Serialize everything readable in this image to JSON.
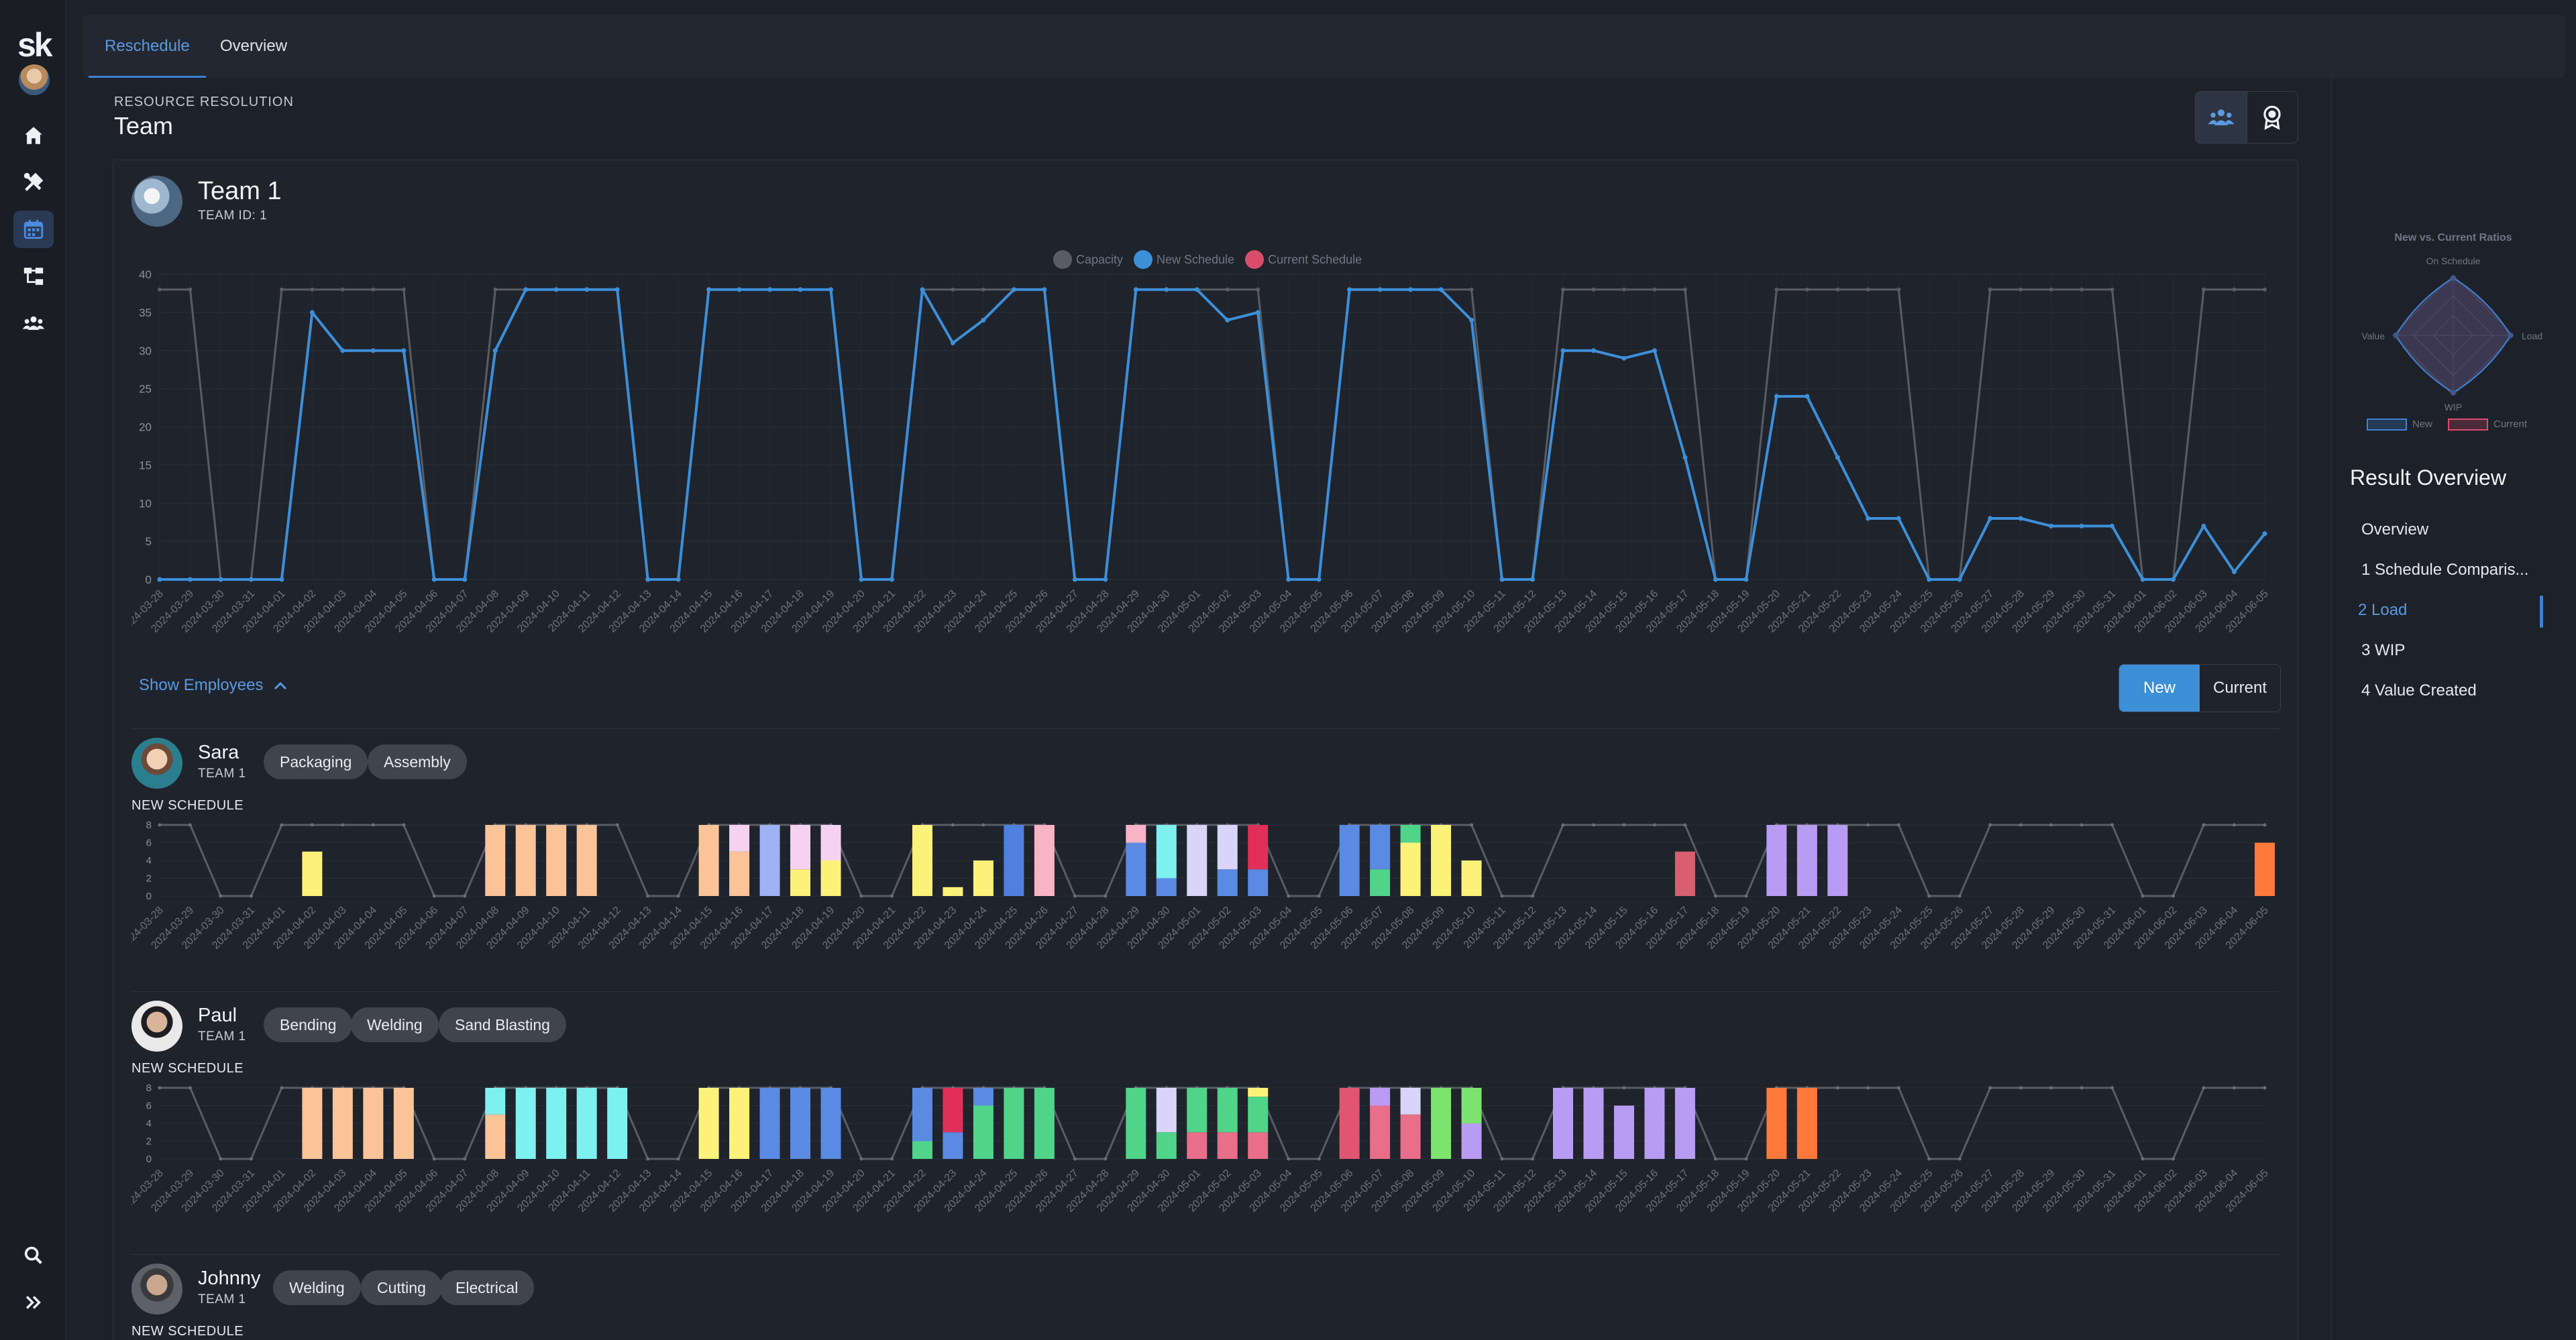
{
  "app": {
    "logo": "sk"
  },
  "nav": {
    "items": [
      {
        "name": "home",
        "icon": "home-icon"
      },
      {
        "name": "tools",
        "icon": "tools-icon"
      },
      {
        "name": "schedule",
        "icon": "calendar-icon",
        "active": true
      },
      {
        "name": "hierarchy",
        "icon": "hierarchy-icon"
      },
      {
        "name": "teams",
        "icon": "team-icon"
      }
    ],
    "bottom": [
      {
        "icon": "search-icon"
      },
      {
        "icon": "expand-icon"
      }
    ]
  },
  "tabs": [
    {
      "label": "Reschedule",
      "active": true
    },
    {
      "label": "Overview",
      "active": false
    }
  ],
  "header": {
    "section_label": "RESOURCE RESOLUTION",
    "title": "Team",
    "view_toggle": [
      {
        "icon": "team-icon",
        "active": true
      },
      {
        "icon": "award-icon",
        "active": false
      }
    ]
  },
  "team": {
    "name": "Team 1",
    "id_label": "TEAM ID: 1",
    "legend": [
      {
        "label": "Capacity",
        "color": "#595c64"
      },
      {
        "label": "New Schedule",
        "color": "#3d8fd8"
      },
      {
        "label": "Current Schedule",
        "color": "#d94d6b"
      }
    ],
    "show_employees_label": "Show Employees",
    "schedule_toggle": {
      "new_label": "New",
      "current_label": "Current",
      "active": "New"
    }
  },
  "chart_data": [
    {
      "type": "line",
      "title": "",
      "x": [
        "2024-03-28",
        "2024-03-29",
        "2024-03-30",
        "2024-03-31",
        "2024-04-01",
        "2024-04-02",
        "2024-04-03",
        "2024-04-04",
        "2024-04-05",
        "2024-04-06",
        "2024-04-07",
        "2024-04-08",
        "2024-04-09",
        "2024-04-10",
        "2024-04-11",
        "2024-04-12",
        "2024-04-13",
        "2024-04-14",
        "2024-04-15",
        "2024-04-16",
        "2024-04-17",
        "2024-04-18",
        "2024-04-19",
        "2024-04-20",
        "2024-04-21",
        "2024-04-22",
        "2024-04-23",
        "2024-04-24",
        "2024-04-25",
        "2024-04-26",
        "2024-04-27",
        "2024-04-28",
        "2024-04-29",
        "2024-04-30",
        "2024-05-01",
        "2024-05-02",
        "2024-05-03",
        "2024-05-04",
        "2024-05-05",
        "2024-05-06",
        "2024-05-07",
        "2024-05-08",
        "2024-05-09",
        "2024-05-10",
        "2024-05-11",
        "2024-05-12",
        "2024-05-13",
        "2024-05-14",
        "2024-05-15",
        "2024-05-16",
        "2024-05-17",
        "2024-05-18",
        "2024-05-19",
        "2024-05-20",
        "2024-05-21",
        "2024-05-22",
        "2024-05-23",
        "2024-05-24",
        "2024-05-25",
        "2024-05-26",
        "2024-05-27",
        "2024-05-28",
        "2024-05-29",
        "2024-05-30",
        "2024-05-31",
        "2024-06-01",
        "2024-06-02",
        "2024-06-03",
        "2024-06-04",
        "2024-06-05"
      ],
      "ylim": [
        0,
        40
      ],
      "yticks": [
        0,
        5,
        10,
        15,
        20,
        25,
        30,
        35,
        40
      ],
      "series": [
        {
          "name": "Capacity",
          "color": "#595c64",
          "values": [
            38,
            38,
            0,
            0,
            38,
            38,
            38,
            38,
            38,
            0,
            0,
            38,
            38,
            38,
            38,
            38,
            0,
            0,
            38,
            38,
            38,
            38,
            38,
            0,
            0,
            38,
            38,
            38,
            38,
            38,
            0,
            0,
            38,
            38,
            38,
            38,
            38,
            0,
            0,
            38,
            38,
            38,
            38,
            38,
            0,
            0,
            38,
            38,
            38,
            38,
            38,
            0,
            0,
            38,
            38,
            38,
            38,
            38,
            0,
            0,
            38,
            38,
            38,
            38,
            38,
            0,
            0,
            38,
            38,
            38
          ]
        },
        {
          "name": "New Schedule",
          "color": "#3d8fd8",
          "values": [
            0,
            0,
            0,
            0,
            0,
            35,
            30,
            30,
            30,
            0,
            0,
            30,
            38,
            38,
            38,
            38,
            0,
            0,
            38,
            38,
            38,
            38,
            38,
            0,
            0,
            38,
            31,
            34,
            38,
            38,
            0,
            0,
            38,
            38,
            38,
            34,
            35,
            0,
            0,
            38,
            38,
            38,
            38,
            34,
            0,
            0,
            30,
            30,
            29,
            30,
            16,
            0,
            0,
            24,
            24,
            16,
            8,
            8,
            0,
            0,
            8,
            8,
            7,
            7,
            7,
            0,
            0,
            7,
            1,
            6
          ]
        },
        {
          "name": "Current Schedule",
          "color": "#d94d6b",
          "values": []
        }
      ]
    },
    {
      "type": "bar",
      "title": "Sara",
      "ylim": [
        0,
        8
      ],
      "yticks": [
        0,
        2,
        4,
        6,
        8
      ],
      "x": [
        "2024-03-28",
        "2024-03-29",
        "2024-03-30",
        "2024-03-31",
        "2024-04-01",
        "2024-04-02",
        "2024-04-03",
        "2024-04-04",
        "2024-04-05",
        "2024-04-06",
        "2024-04-07",
        "2024-04-08",
        "2024-04-09",
        "2024-04-10",
        "2024-04-11",
        "2024-04-12",
        "2024-04-13",
        "2024-04-14",
        "2024-04-15",
        "2024-04-16",
        "2024-04-17",
        "2024-04-18",
        "2024-04-19",
        "2024-04-20",
        "2024-04-21",
        "2024-04-22",
        "2024-04-23",
        "2024-04-24",
        "2024-04-25",
        "2024-04-26",
        "2024-04-27",
        "2024-04-28",
        "2024-04-29",
        "2024-04-30",
        "2024-05-01",
        "2024-05-02",
        "2024-05-03",
        "2024-05-04",
        "2024-05-05",
        "2024-05-06",
        "2024-05-07",
        "2024-05-08",
        "2024-05-09",
        "2024-05-10",
        "2024-05-11",
        "2024-05-12",
        "2024-05-13",
        "2024-05-14",
        "2024-05-15",
        "2024-05-16",
        "2024-05-17",
        "2024-05-18",
        "2024-05-19",
        "2024-05-20",
        "2024-05-21",
        "2024-05-22",
        "2024-05-23",
        "2024-05-24",
        "2024-05-25",
        "2024-05-26",
        "2024-05-27",
        "2024-05-28",
        "2024-05-29",
        "2024-05-30",
        "2024-05-31",
        "2024-06-01",
        "2024-06-02",
        "2024-06-03",
        "2024-06-04",
        "2024-06-05"
      ],
      "capacity": [
        8,
        8,
        0,
        0,
        8,
        8,
        8,
        8,
        8,
        0,
        0,
        8,
        8,
        8,
        8,
        8,
        0,
        0,
        8,
        8,
        8,
        8,
        8,
        0,
        0,
        8,
        8,
        8,
        8,
        8,
        0,
        0,
        8,
        8,
        8,
        8,
        8,
        0,
        0,
        8,
        8,
        8,
        8,
        8,
        0,
        0,
        8,
        8,
        8,
        8,
        8,
        0,
        0,
        8,
        8,
        8,
        8,
        8,
        0,
        0,
        8,
        8,
        8,
        8,
        8,
        0,
        0,
        8,
        8,
        8
      ],
      "bars": {
        "5": [
          [
            5,
            "#fdf279"
          ]
        ],
        "11": [
          [
            8,
            "#fbc398"
          ]
        ],
        "12": [
          [
            8,
            "#fbc398"
          ]
        ],
        "13": [
          [
            8,
            "#fbc398"
          ]
        ],
        "14": [
          [
            8,
            "#fbc398"
          ]
        ],
        "18": [
          [
            8,
            "#fbc398"
          ]
        ],
        "19": [
          [
            5,
            "#fbc398"
          ],
          [
            3,
            "#f6d2f0"
          ]
        ],
        "20": [
          [
            8,
            "#9fb2f3"
          ]
        ],
        "21": [
          [
            3,
            "#fdf279"
          ],
          [
            5,
            "#f6d2f0"
          ]
        ],
        "22": [
          [
            4,
            "#fdf279"
          ],
          [
            4,
            "#f6d2f0"
          ]
        ],
        "25": [
          [
            8,
            "#fdf279"
          ]
        ],
        "26": [
          [
            1,
            "#fdf279"
          ]
        ],
        "27": [
          [
            4,
            "#fdf279"
          ]
        ],
        "28": [
          [
            8,
            "#4f80df"
          ]
        ],
        "29": [
          [
            8,
            "#f8b4c4"
          ]
        ],
        "32": [
          [
            6,
            "#5b8ae3"
          ],
          [
            2,
            "#f8b4c4"
          ]
        ],
        "33": [
          [
            2,
            "#5b8ae3"
          ],
          [
            6,
            "#7df0f0"
          ]
        ],
        "34": [
          [
            8,
            "#d9d4f8"
          ]
        ],
        "35": [
          [
            3,
            "#5b8ae3"
          ],
          [
            5,
            "#d9d4f8"
          ]
        ],
        "36": [
          [
            3,
            "#5b8ae3"
          ],
          [
            5,
            "#e0305a"
          ]
        ],
        "39": [
          [
            8,
            "#5b8ae3"
          ]
        ],
        "40": [
          [
            3,
            "#4fd48a"
          ],
          [
            5,
            "#5b8ae3"
          ]
        ],
        "41": [
          [
            6,
            "#fdf279"
          ],
          [
            2,
            "#4fd48a"
          ]
        ],
        "42": [
          [
            8,
            "#fdf279"
          ]
        ],
        "43": [
          [
            4,
            "#fdf279"
          ]
        ],
        "50": [
          [
            5,
            "#d75f6e"
          ]
        ],
        "53": [
          [
            8,
            "#b89cf3"
          ]
        ],
        "54": [
          [
            8,
            "#b89cf3"
          ]
        ],
        "55": [
          [
            8,
            "#b89cf3"
          ]
        ],
        "69": [
          [
            6,
            "#ff7a3a"
          ]
        ]
      }
    },
    {
      "type": "bar",
      "title": "Paul",
      "ylim": [
        0,
        8
      ],
      "yticks": [
        0,
        2,
        4,
        6,
        8
      ],
      "x": [
        "2024-03-28",
        "2024-03-29",
        "2024-03-30",
        "2024-03-31",
        "2024-04-01",
        "2024-04-02",
        "2024-04-03",
        "2024-04-04",
        "2024-04-05",
        "2024-04-06",
        "2024-04-07",
        "2024-04-08",
        "2024-04-09",
        "2024-04-10",
        "2024-04-11",
        "2024-04-12",
        "2024-04-13",
        "2024-04-14",
        "2024-04-15",
        "2024-04-16",
        "2024-04-17",
        "2024-04-18",
        "2024-04-19",
        "2024-04-20",
        "2024-04-21",
        "2024-04-22",
        "2024-04-23",
        "2024-04-24",
        "2024-04-25",
        "2024-04-26",
        "2024-04-27",
        "2024-04-28",
        "2024-04-29",
        "2024-04-30",
        "2024-05-01",
        "2024-05-02",
        "2024-05-03",
        "2024-05-04",
        "2024-05-05",
        "2024-05-06",
        "2024-05-07",
        "2024-05-08",
        "2024-05-09",
        "2024-05-10",
        "2024-05-11",
        "2024-05-12",
        "2024-05-13",
        "2024-05-14",
        "2024-05-15",
        "2024-05-16",
        "2024-05-17",
        "2024-05-18",
        "2024-05-19",
        "2024-05-20",
        "2024-05-21",
        "2024-05-22",
        "2024-05-23",
        "2024-05-24",
        "2024-05-25",
        "2024-05-26",
        "2024-05-27",
        "2024-05-28",
        "2024-05-29",
        "2024-05-30",
        "2024-05-31",
        "2024-06-01",
        "2024-06-02",
        "2024-06-03",
        "2024-06-04",
        "2024-06-05"
      ],
      "capacity": [
        8,
        8,
        0,
        0,
        8,
        8,
        8,
        8,
        8,
        0,
        0,
        8,
        8,
        8,
        8,
        8,
        0,
        0,
        8,
        8,
        8,
        8,
        8,
        0,
        0,
        8,
        8,
        8,
        8,
        8,
        0,
        0,
        8,
        8,
        8,
        8,
        8,
        0,
        0,
        8,
        8,
        8,
        8,
        8,
        0,
        0,
        8,
        8,
        8,
        8,
        8,
        0,
        0,
        8,
        8,
        8,
        8,
        8,
        0,
        0,
        8,
        8,
        8,
        8,
        8,
        0,
        0,
        8,
        8,
        8
      ],
      "bars": {
        "5": [
          [
            8,
            "#fbc398"
          ]
        ],
        "6": [
          [
            8,
            "#fbc398"
          ]
        ],
        "7": [
          [
            8,
            "#fbc398"
          ]
        ],
        "8": [
          [
            8,
            "#fbc398"
          ]
        ],
        "11": [
          [
            5,
            "#fbc398"
          ],
          [
            3,
            "#7df0f0"
          ]
        ],
        "12": [
          [
            8,
            "#7df0f0"
          ]
        ],
        "13": [
          [
            8,
            "#7df0f0"
          ]
        ],
        "14": [
          [
            8,
            "#7df0f0"
          ]
        ],
        "15": [
          [
            8,
            "#7df0f0"
          ]
        ],
        "18": [
          [
            8,
            "#fdf279"
          ]
        ],
        "19": [
          [
            8,
            "#fdf279"
          ]
        ],
        "20": [
          [
            8,
            "#5b8ae3"
          ]
        ],
        "21": [
          [
            8,
            "#5b8ae3"
          ]
        ],
        "22": [
          [
            8,
            "#5b8ae3"
          ]
        ],
        "25": [
          [
            2,
            "#4fd48a"
          ],
          [
            6,
            "#5b8ae3"
          ]
        ],
        "26": [
          [
            3,
            "#5b8ae3"
          ],
          [
            5,
            "#e0305a"
          ]
        ],
        "27": [
          [
            6,
            "#4fd48a"
          ],
          [
            2,
            "#5b8ae3"
          ]
        ],
        "28": [
          [
            8,
            "#4fd48a"
          ]
        ],
        "29": [
          [
            8,
            "#4fd48a"
          ]
        ],
        "32": [
          [
            8,
            "#4fd48a"
          ]
        ],
        "33": [
          [
            3,
            "#4fd48a"
          ],
          [
            5,
            "#d9d4f8"
          ]
        ],
        "34": [
          [
            3,
            "#e86e8a"
          ],
          [
            5,
            "#4fd48a"
          ]
        ],
        "35": [
          [
            3,
            "#e86e8a"
          ],
          [
            5,
            "#4fd48a"
          ]
        ],
        "36": [
          [
            3,
            "#e86e8a"
          ],
          [
            4,
            "#4fd48a"
          ],
          [
            1,
            "#fdf279"
          ]
        ],
        "39": [
          [
            8,
            "#e0556f"
          ]
        ],
        "40": [
          [
            6,
            "#e86e8a"
          ],
          [
            2,
            "#b89cf3"
          ]
        ],
        "41": [
          [
            5,
            "#e86e8a"
          ],
          [
            3,
            "#d9d4f8"
          ]
        ],
        "42": [
          [
            8,
            "#7de36e"
          ]
        ],
        "43": [
          [
            4,
            "#b89cf3"
          ],
          [
            4,
            "#7de36e"
          ]
        ],
        "46": [
          [
            8,
            "#b89cf3"
          ]
        ],
        "47": [
          [
            8,
            "#b89cf3"
          ]
        ],
        "48": [
          [
            6,
            "#b89cf3"
          ]
        ],
        "49": [
          [
            8,
            "#b89cf3"
          ]
        ],
        "50": [
          [
            8,
            "#b89cf3"
          ]
        ],
        "53": [
          [
            8,
            "#ff7a3a"
          ]
        ],
        "54": [
          [
            8,
            "#ff7a3a"
          ]
        ]
      }
    }
  ],
  "employees": [
    {
      "name": "Sara",
      "team": "TEAM 1",
      "skills": [
        "Packaging",
        "Assembly"
      ],
      "schedule_label": "NEW SCHEDULE"
    },
    {
      "name": "Paul",
      "team": "TEAM 1",
      "skills": [
        "Bending",
        "Welding",
        "Sand Blasting"
      ],
      "schedule_label": "NEW SCHEDULE"
    },
    {
      "name": "Johnny",
      "team": "TEAM 1",
      "skills": [
        "Welding",
        "Cutting",
        "Electrical"
      ],
      "schedule_label": "NEW SCHEDULE"
    }
  ],
  "radar": {
    "title": "New vs. Current Ratios",
    "axes": [
      "On Schedule",
      "Load",
      "WIP",
      "Value"
    ],
    "legend": [
      {
        "label": "New",
        "color": "#3d82d1"
      },
      {
        "label": "Current",
        "color": "#d94d6b"
      }
    ],
    "values": {
      "new": [
        0.95,
        0.95,
        0.95,
        0.95
      ],
      "current": [
        0.95,
        0.95,
        0.95,
        0.95
      ]
    }
  },
  "result_overview": {
    "title": "Result Overview",
    "items": [
      {
        "label": "Overview",
        "active": false
      },
      {
        "label": "1 Schedule Comparis...",
        "active": false
      },
      {
        "label": "2 Load",
        "active": true
      },
      {
        "label": "3 WIP",
        "active": false
      },
      {
        "label": "4 Value Created",
        "active": false
      }
    ]
  }
}
